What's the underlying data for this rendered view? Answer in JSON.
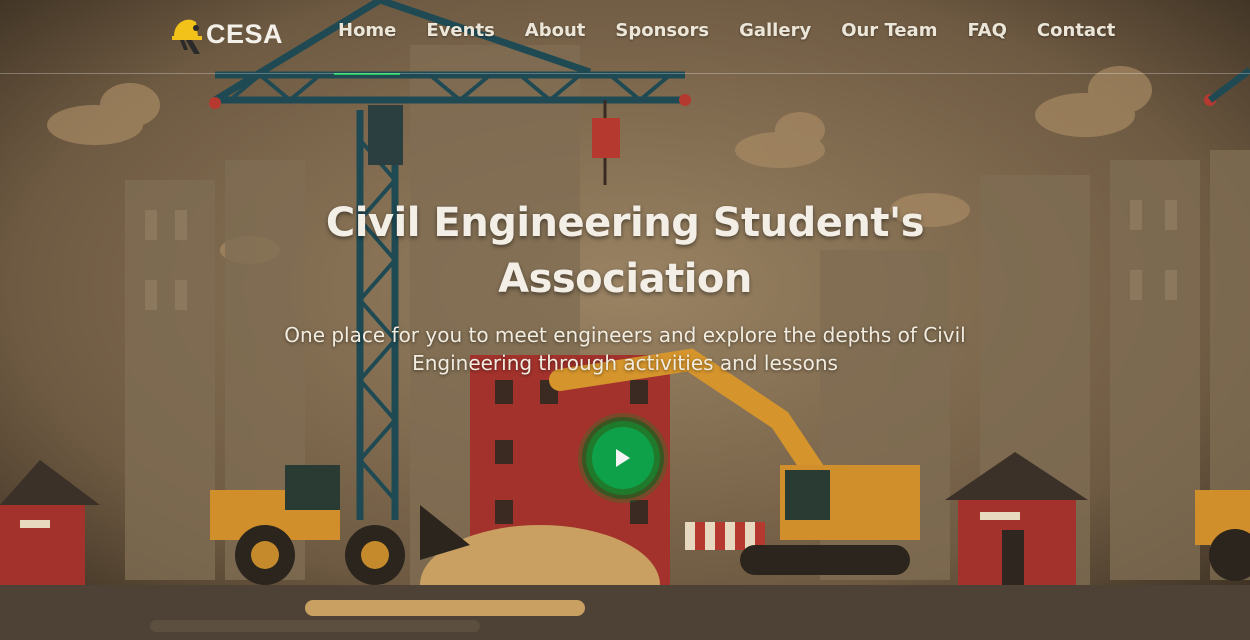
{
  "brand": {
    "name": "CESA",
    "logo_icon": "hardhat-helmet-icon"
  },
  "nav": {
    "items": [
      {
        "label": "Home",
        "active": true
      },
      {
        "label": "Events",
        "active": false
      },
      {
        "label": "About",
        "active": false
      },
      {
        "label": "Sponsors",
        "active": false
      },
      {
        "label": "Gallery",
        "active": false
      },
      {
        "label": "Our Team",
        "active": false
      },
      {
        "label": "FAQ",
        "active": false
      },
      {
        "label": "Contact",
        "active": false
      }
    ]
  },
  "hero": {
    "title": "Civil Engineering Student's Association",
    "subtitle": "One place for you to meet engineers and explore the depths of Civil Engineering through activities and lessons",
    "play_icon": "play-icon"
  },
  "colors": {
    "accent": "#0fa14a",
    "background": "#6b5840",
    "text": "#f3efe6"
  }
}
